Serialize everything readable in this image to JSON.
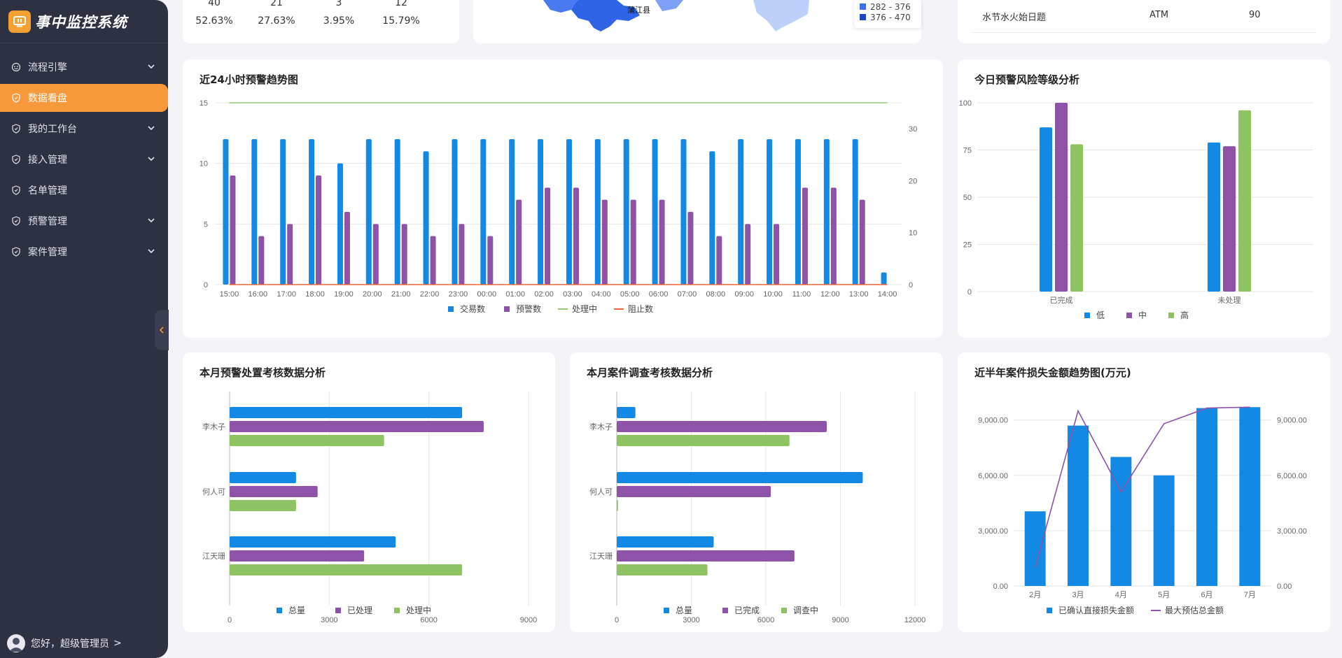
{
  "app": {
    "title": "事中监控系统"
  },
  "sidebar": {
    "items": [
      {
        "label": "流程引擎",
        "has_children": true,
        "active": false,
        "icon": "flow-icon"
      },
      {
        "label": "数据看盘",
        "has_children": false,
        "active": true,
        "icon": "shield-icon"
      },
      {
        "label": "我的工作台",
        "has_children": true,
        "active": false,
        "icon": "shield-icon"
      },
      {
        "label": "接入管理",
        "has_children": true,
        "active": false,
        "icon": "shield-icon"
      },
      {
        "label": "名单管理",
        "has_children": false,
        "active": false,
        "icon": "shield-icon"
      },
      {
        "label": "预警管理",
        "has_children": true,
        "active": false,
        "icon": "shield-icon"
      },
      {
        "label": "案件管理",
        "has_children": true,
        "active": false,
        "icon": "shield-icon"
      }
    ],
    "user_greeting": "您好，超级管理员",
    "user_arrow": ">"
  },
  "top_stats": {
    "counts": [
      "40",
      "21",
      "3",
      "12"
    ],
    "percents": [
      "52.63%",
      "27.63%",
      "3.95%",
      "15.79%"
    ]
  },
  "top_map": {
    "region_label": "蒲江县",
    "legend": [
      {
        "label": "282 - 376",
        "color": "#3f6ff0"
      },
      {
        "label": "376 - 470",
        "color": "#1f45c4"
      }
    ]
  },
  "top_table": {
    "row": {
      "name": "水节水火始日题",
      "channel": "ATM",
      "value": "90"
    }
  },
  "colors": {
    "blue": "#1389e6",
    "purple": "#8e52a8",
    "green": "#8dc361",
    "orange": "#f5993a",
    "line_green": "#91cc75",
    "line_orange": "#ee6633"
  },
  "charts": {
    "trend24": {
      "title": "近24小时预警趋势图",
      "chart_data": {
        "type": "bar",
        "categories": [
          "15:00",
          "16:00",
          "17:00",
          "18:00",
          "19:00",
          "20:00",
          "21:00",
          "22:00",
          "23:00",
          "00:00",
          "01:00",
          "02:00",
          "03:00",
          "04:00",
          "05:00",
          "06:00",
          "07:00",
          "08:00",
          "09:00",
          "10:00",
          "11:00",
          "12:00",
          "13:00",
          "14:00"
        ],
        "series": [
          {
            "name": "交易数",
            "kind": "bar",
            "axis": "left",
            "values": [
              12,
              12,
              12,
              12,
              10,
              12,
              12,
              11,
              12,
              12,
              12,
              12,
              12,
              12,
              12,
              12,
              12,
              11,
              12,
              12,
              12,
              12,
              12,
              1
            ]
          },
          {
            "name": "预警数",
            "kind": "bar",
            "axis": "left",
            "values": [
              9,
              4,
              5,
              9,
              6,
              5,
              5,
              4,
              5,
              4,
              7,
              8,
              8,
              7,
              7,
              7,
              6,
              4,
              5,
              5,
              8,
              8,
              7,
              0
            ]
          },
          {
            "name": "处理中",
            "kind": "line",
            "axis": "left",
            "values": [
              15,
              15,
              15,
              15,
              15,
              15,
              15,
              15,
              15,
              15,
              15,
              15,
              15,
              15,
              15,
              15,
              15,
              15,
              15,
              15,
              15,
              15,
              15,
              15
            ]
          },
          {
            "name": "阻止数",
            "kind": "line",
            "axis": "right",
            "values": [
              0,
              0,
              0,
              0,
              0,
              0,
              0,
              0,
              0,
              0,
              0,
              0,
              0,
              0,
              0,
              0,
              0,
              0,
              0,
              0,
              0,
              0,
              0,
              0
            ]
          }
        ],
        "ylim_left": [
          0,
          15
        ],
        "yticks_left": [
          0,
          5,
          10,
          15
        ],
        "ylim_right": [
          0,
          35
        ],
        "yticks_right": [
          0,
          10,
          20,
          30
        ],
        "grid": true,
        "legend": "bottom"
      }
    },
    "risk": {
      "title": "今日预警风险等级分析",
      "chart_data": {
        "type": "bar",
        "categories": [
          "已完成",
          "未处理"
        ],
        "series": [
          {
            "name": "低",
            "values": [
              87,
              79
            ]
          },
          {
            "name": "中",
            "values": [
              100,
              77
            ]
          },
          {
            "name": "高",
            "values": [
              78,
              96
            ]
          }
        ],
        "ylim": [
          0,
          100
        ],
        "yticks": [
          0,
          25,
          50,
          75,
          100
        ],
        "grid": true,
        "legend": "bottom"
      }
    },
    "alert_assess": {
      "title": "本月预警处置考核数据分析",
      "chart_data": {
        "type": "bar",
        "orientation": "horizontal",
        "categories": [
          "李木子",
          "何人可",
          "江天珊"
        ],
        "series": [
          {
            "name": "总量",
            "values": [
              7000,
              2000,
              5000
            ]
          },
          {
            "name": "已处理",
            "values": [
              7650,
              2650,
              4050
            ]
          },
          {
            "name": "处理中",
            "values": [
              4650,
              2000,
              7000
            ]
          }
        ],
        "xlim": [
          0,
          9000
        ],
        "xticks": [
          0,
          3000,
          6000,
          9000
        ],
        "grid": true,
        "legend": "bottom"
      }
    },
    "case_assess": {
      "title": "本月案件调查考核数据分析",
      "chart_data": {
        "type": "bar",
        "orientation": "horizontal",
        "categories": [
          "李木子",
          "何人可",
          "江天珊"
        ],
        "series": [
          {
            "name": "总量",
            "values": [
              750,
              9900,
              3900
            ]
          },
          {
            "name": "已完成",
            "values": [
              8450,
              6200,
              7150
            ]
          },
          {
            "name": "调查中",
            "values": [
              6950,
              50,
              3650
            ]
          }
        ],
        "xlim": [
          0,
          12000
        ],
        "xticks": [
          0,
          3000,
          6000,
          9000,
          12000
        ],
        "grid": true,
        "legend": "bottom"
      }
    },
    "loss": {
      "title": "近半年案件损失金额趋势图(万元)",
      "chart_data": {
        "type": "bar",
        "categories": [
          "2月",
          "3月",
          "4月",
          "5月",
          "6月",
          "7月"
        ],
        "series": [
          {
            "name": "已确认直接损失金额",
            "kind": "bar",
            "values": [
              4050,
              8700,
              7000,
              6000,
              9650,
              9700
            ]
          },
          {
            "name": "最大预估总金额",
            "kind": "line",
            "values": [
              1000,
              9500,
              5100,
              8800,
              9650,
              9700
            ]
          }
        ],
        "ylim": [
          0,
          11000
        ],
        "yticks": [
          0,
          3000,
          6000,
          9000
        ],
        "ytick_labels": [
          "0.00",
          "3,000.00",
          "6,000.00",
          "9,000.00"
        ],
        "grid": true,
        "legend": "bottom"
      }
    }
  }
}
